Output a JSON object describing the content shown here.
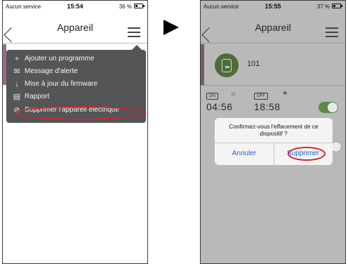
{
  "left": {
    "status": {
      "carrier": "Aucun service",
      "time": "15:54",
      "battery": "36 %",
      "battery_level": 0.36
    },
    "title": "Appareil",
    "menu": [
      {
        "icon": "plus-icon",
        "glyph": "+",
        "label": "Ajouter un programme"
      },
      {
        "icon": "message-icon",
        "glyph": "✉",
        "label": "Message d'alerte"
      },
      {
        "icon": "download-icon",
        "glyph": "↓",
        "label": "Mise à jour du firmware"
      },
      {
        "icon": "report-icon",
        "glyph": "▤",
        "label": "Rapport"
      },
      {
        "icon": "delete-icon",
        "glyph": "⊘",
        "label": "Supprimer l'appareil électrique"
      }
    ]
  },
  "right": {
    "status": {
      "carrier": "Aucun service",
      "time": "15:55",
      "battery": "37 %",
      "battery_level": 0.37
    },
    "title": "Appareil",
    "device_name": "101",
    "program": {
      "on_tag": "ON",
      "off_tag": "OFF",
      "on_time": "04:56",
      "off_time": "18:58"
    },
    "dialog": {
      "message": "Confirmez-vous l'effacement de ce dispositif ?",
      "cancel": "Annuler",
      "confirm": "Supprimer"
    }
  },
  "colors": {
    "highlight": "#d4232d",
    "dialog_button": "#1e5fd8",
    "menu_bg": "#535557"
  }
}
